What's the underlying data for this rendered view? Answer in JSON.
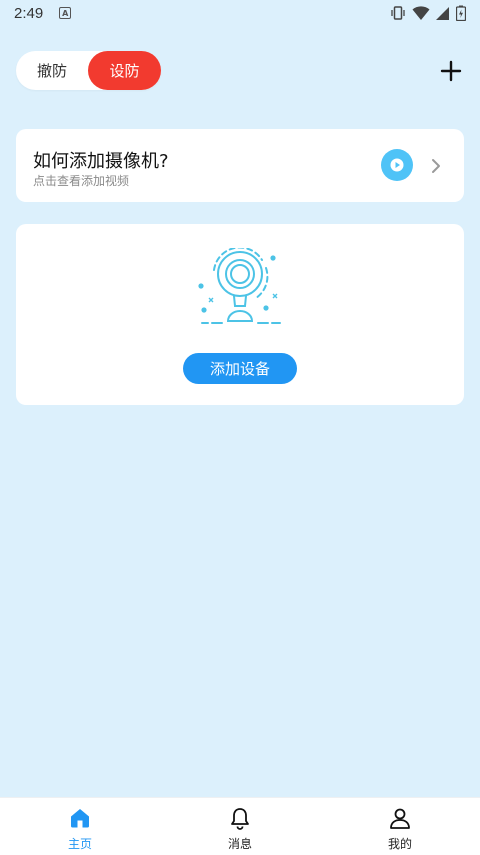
{
  "status_bar": {
    "time": "2:49",
    "notification_icon": "a-icon",
    "icons": [
      "vibrate-icon",
      "wifi-icon",
      "signal-icon",
      "battery-icon"
    ]
  },
  "header": {
    "mode_options": [
      "撤防",
      "设防"
    ],
    "active_mode": "设防",
    "add_icon": "plus-icon"
  },
  "help_card": {
    "title": "如何添加摄像机?",
    "subtitle": "点击查看添加视频",
    "play_icon": "play-icon",
    "chevron_icon": "chevron-right-icon"
  },
  "device_card": {
    "illustration": "camera-icon",
    "add_button": "添加设备"
  },
  "bottom_nav": {
    "items": [
      {
        "label": "主页",
        "icon": "home-icon",
        "active": true
      },
      {
        "label": "消息",
        "icon": "bell-icon",
        "active": false
      },
      {
        "label": "我的",
        "icon": "person-icon",
        "active": false
      }
    ]
  },
  "colors": {
    "background": "#dcf0fc",
    "active_mode": "#f23a2f",
    "primary": "#2196f3",
    "play": "#4fc3f7",
    "illustration": "#4cc3e6"
  }
}
